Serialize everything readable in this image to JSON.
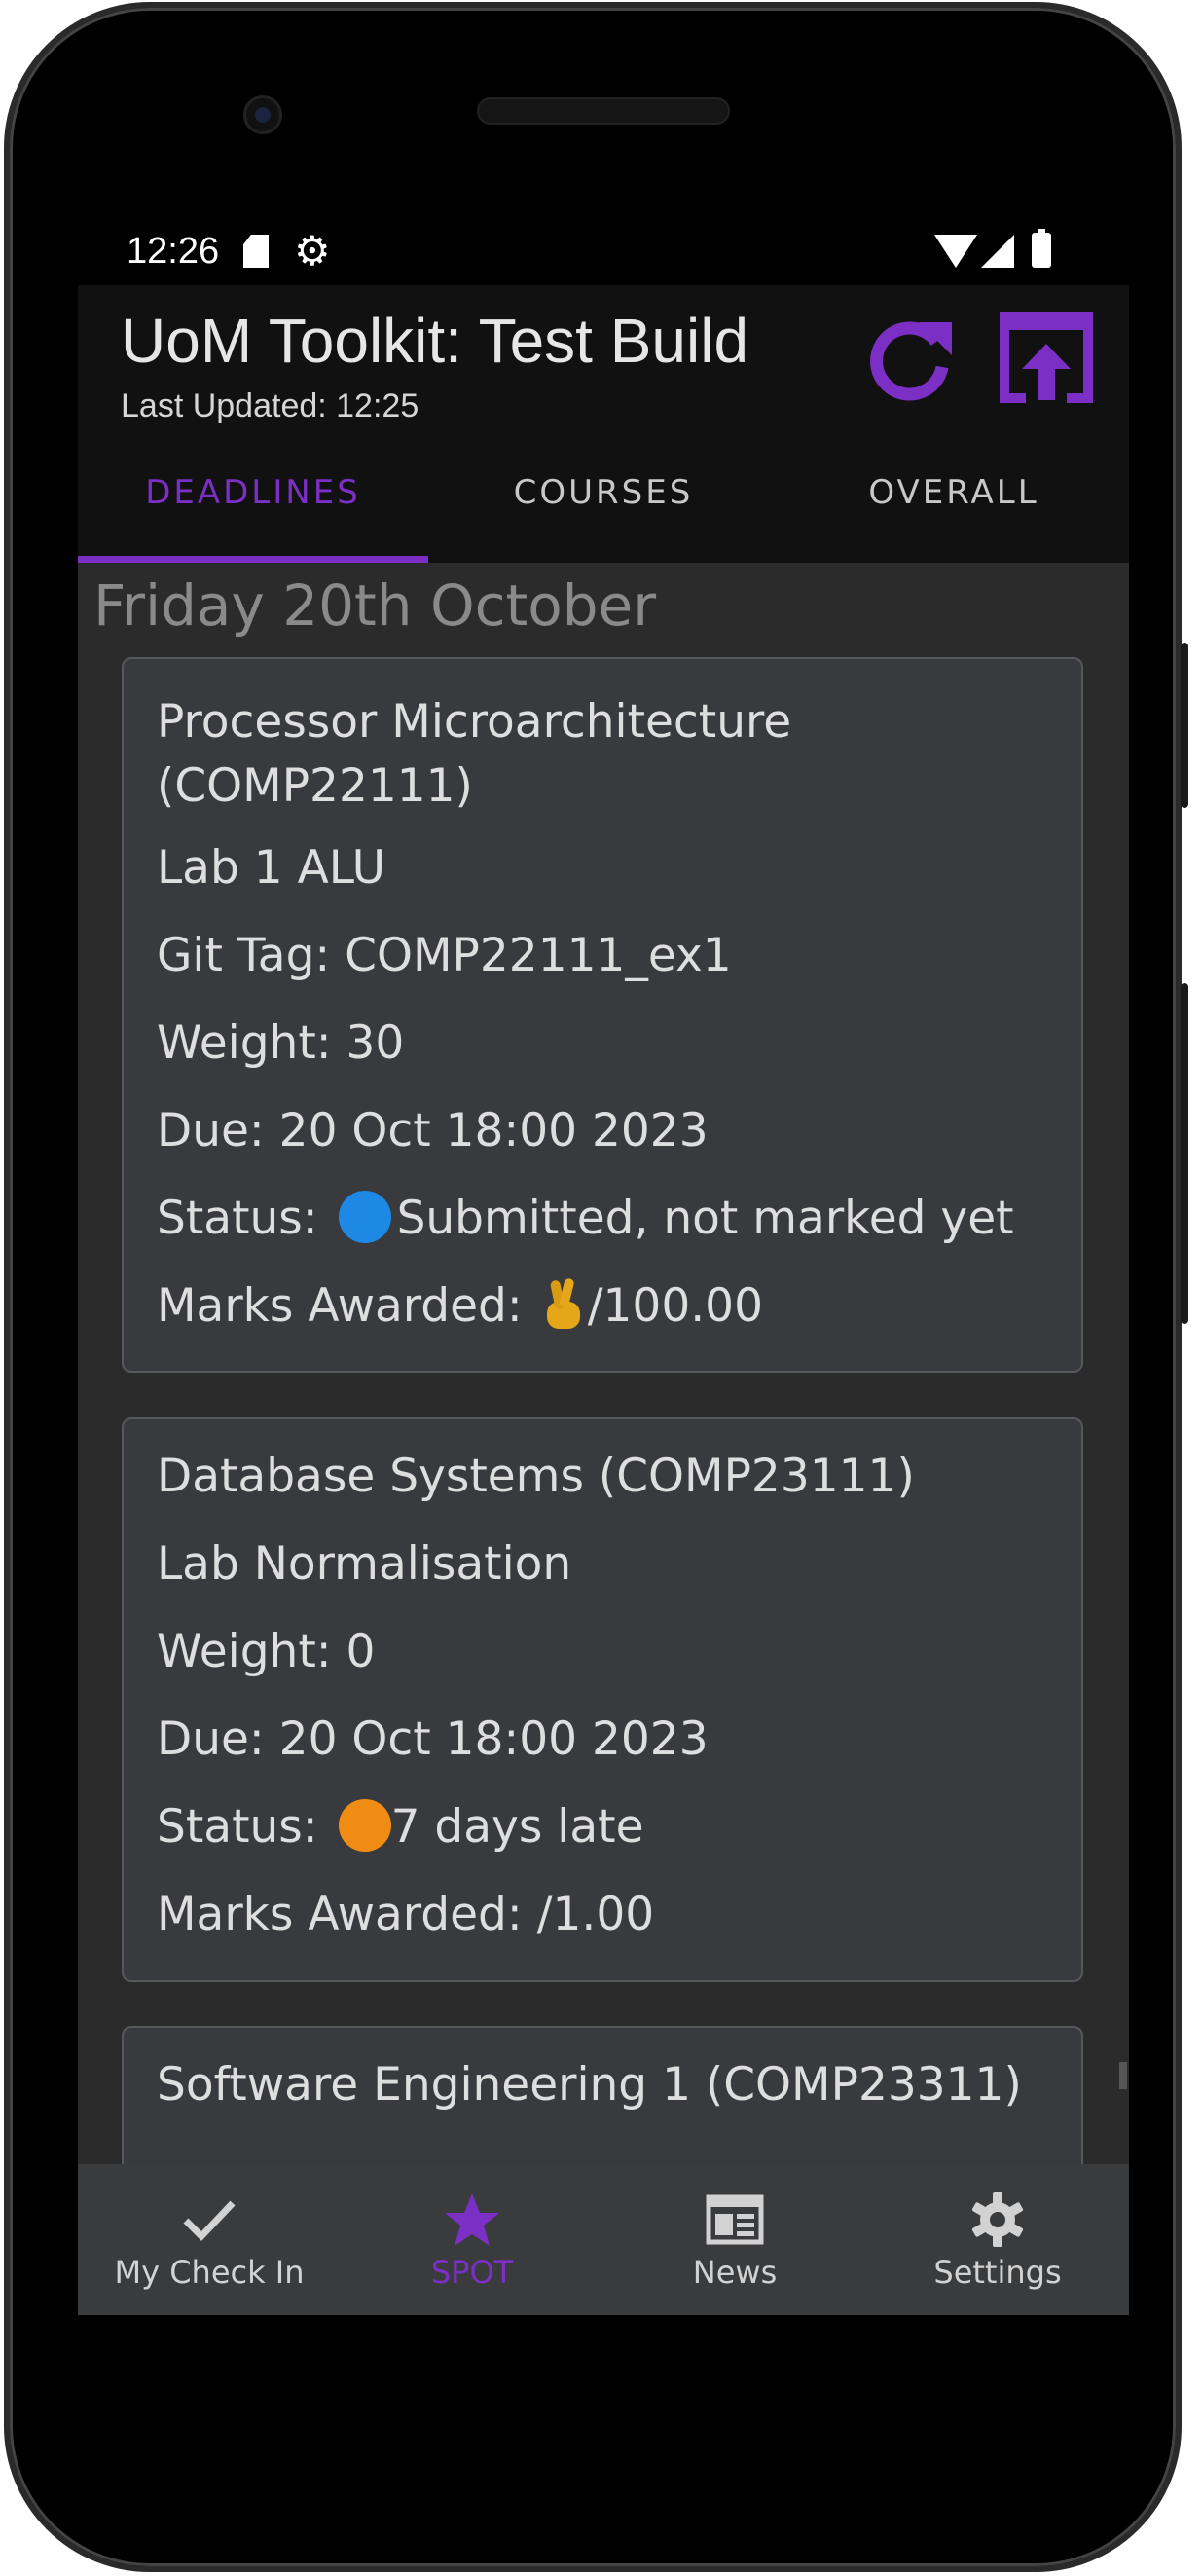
{
  "status_bar": {
    "time": "12:26"
  },
  "app_bar": {
    "title": "UoM Toolkit: Test Build",
    "subtitle": "Last Updated: 12:25",
    "refresh_icon": "refresh-icon",
    "open_icon": "open-in-app-icon",
    "accent": "#7b2fc4"
  },
  "tabs": [
    {
      "label": "DEADLINES",
      "active": true
    },
    {
      "label": "COURSES",
      "active": false
    },
    {
      "label": "OVERALL",
      "active": false
    }
  ],
  "content": {
    "date_header": "Friday 20th October",
    "cards": [
      {
        "course": "Processor Microarchitecture (COMP22111)",
        "name": "Lab 1 ALU",
        "git_tag": "Git Tag: COMP22111_ex1",
        "weight": "Weight: 30",
        "due": "Due: 20 Oct 18:00 2023",
        "status_prefix": "Status:",
        "status_text": "Submitted, not marked yet",
        "status_color": "#1e88e5",
        "marks_prefix": "Marks Awarded:",
        "marks_emoji": "fingers-crossed-emoji",
        "marks_value": "/100.00"
      },
      {
        "course": "Database Systems (COMP23111)",
        "name": "Lab Normalisation",
        "weight": "Weight: 0",
        "due": "Due: 20 Oct 18:00 2023",
        "status_prefix": "Status:",
        "status_text": "7 days late",
        "status_color": "#f08c14",
        "marks": "Marks Awarded: /1.00"
      },
      {
        "course": "Software Engineering 1 (COMP23311)"
      }
    ]
  },
  "bottom_nav": [
    {
      "label": "My Check In",
      "icon": "check-icon",
      "active": false
    },
    {
      "label": "SPOT",
      "icon": "star-icon",
      "active": true
    },
    {
      "label": "News",
      "icon": "newspaper-icon",
      "active": false
    },
    {
      "label": "Settings",
      "icon": "gear-icon",
      "active": false
    }
  ]
}
